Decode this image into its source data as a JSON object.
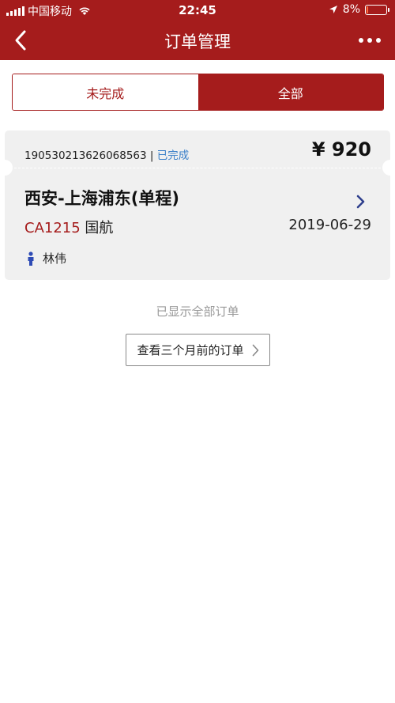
{
  "status_bar": {
    "carrier": "中国移动",
    "time": "22:45",
    "battery": "8%",
    "battery_level": 0.08
  },
  "header": {
    "title": "订单管理",
    "back_icon": "back-chevron-icon",
    "more_icon": "more-dots-icon"
  },
  "tabs": [
    {
      "label": "未完成",
      "active": false
    },
    {
      "label": "全部",
      "active": true
    }
  ],
  "order": {
    "number": "190530213626068563",
    "separator": " | ",
    "status": "已完成",
    "price": "¥ 920",
    "route": "西安-上海浦东(单程)",
    "flight_no": "CA1215",
    "airline": " 国航",
    "date": "2019-06-29",
    "passenger": "林伟"
  },
  "footer": {
    "all_shown": "已显示全部订单",
    "older_orders_label": "查看三个月前的订单"
  },
  "colors": {
    "brand_red": "#a51c1c",
    "status_blue": "#3a7fc8"
  }
}
